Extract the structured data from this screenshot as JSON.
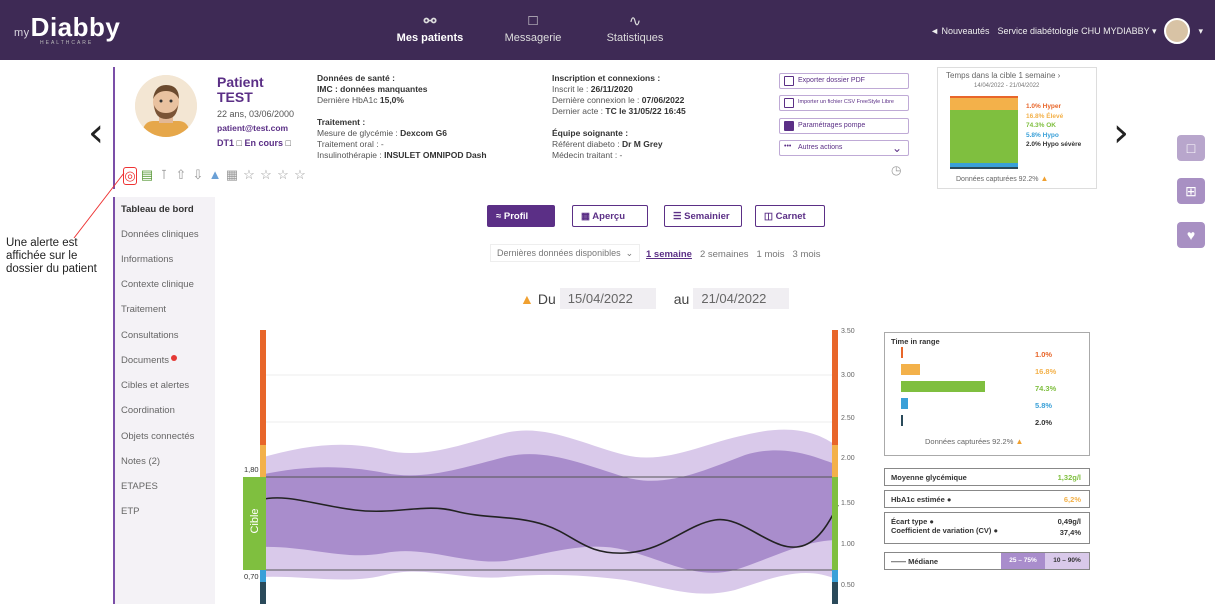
{
  "app": {
    "logo_prefix": "my",
    "logo_name": "Diabby",
    "logo_sub": "HEALTHCARE"
  },
  "nav": [
    {
      "label": "Mes patients",
      "icon": "patients-icon",
      "active": true
    },
    {
      "label": "Messagerie",
      "icon": "chat-icon",
      "active": false
    },
    {
      "label": "Statistiques",
      "icon": "stats-icon",
      "active": false
    }
  ],
  "topright": {
    "news": "Nouveautés",
    "service": "Service diabétologie CHU MYDIABBY"
  },
  "patient": {
    "label": "Patient",
    "lastname": "TEST",
    "age_birth": "22 ans, 03/06/2000",
    "email": "patient@test.com",
    "type": "DT1",
    "status": "En cours"
  },
  "health": {
    "title": "Données de santé :",
    "imc": "IMC : données manquantes",
    "hba1c_label": "Dernière HbA1c",
    "hba1c_value": "15,0%",
    "treatment_title": "Traitement :",
    "glycemia_label": "Mesure de glycémie :",
    "glycemia_value": "Dexcom G6",
    "oral": "Traitement oral : -",
    "insulin_label": "Insulinothérapie :",
    "insulin_value": "INSULET OMNIPOD Dash"
  },
  "inscription": {
    "title": "Inscription et connexions :",
    "registered_label": "Inscrit le :",
    "registered_value": "26/11/2020",
    "lastlogin_label": "Dernière connexion le :",
    "lastlogin_value": "07/06/2022",
    "lastact_label": "Dernier acte :",
    "lastact_value": "TC le 31/05/22 16:45",
    "team_title": "Équipe soignante :",
    "referent_label": "Référent diabeto :",
    "referent_value": "Dr M Grey",
    "gp": "Médecin traitant : -"
  },
  "actions": {
    "export_pdf": "Exporter dossier PDF",
    "import_csv": "Importer un fichier CSV FreeStyle Libre",
    "pump": "Paramétrages pompe",
    "other": "Autres actions"
  },
  "tir_card": {
    "title": "Temps dans la cible 1 semaine",
    "period": "14/04/2022 - 21/04/2022",
    "items": [
      {
        "value": "1.0%",
        "label": "Hyper",
        "color": "#e8662a"
      },
      {
        "value": "16.8%",
        "label": "Élevé",
        "color": "#f3b14a"
      },
      {
        "value": "74.3%",
        "label": "OK",
        "color": "#7fbf3f"
      },
      {
        "value": "5.8%",
        "label": "Hypo",
        "color": "#3aa0d8"
      },
      {
        "value": "2.0%",
        "label": "Hypo sévère",
        "color": "#2a4a5a"
      }
    ],
    "captured": "Données capturées 92.2%"
  },
  "menu": [
    "Tableau de bord",
    "Données cliniques",
    "Informations",
    "Contexte clinique",
    "Traitement",
    "Consultations",
    "Documents",
    "Cibles et alertes",
    "Coordination",
    "Objets connectés",
    "Notes (2)",
    "ETAPES",
    "ETP"
  ],
  "annotation": "Une alerte est affichée sur le dossier du patient",
  "views": [
    "Profil",
    "Aperçu",
    "Semainier",
    "Carnet"
  ],
  "range": {
    "select": "Dernières données disponibles",
    "periods": [
      "1 semaine",
      "2 semaines",
      "1 mois",
      "3 mois"
    ],
    "from_label": "Du",
    "from": "15/04/2022",
    "to_label": "au",
    "to": "21/04/2022"
  },
  "chart_data": {
    "type": "area",
    "y_right_ticks": [
      "3.50",
      "3.00",
      "2.50",
      "2.00",
      "1.50",
      "1.00",
      "0.50"
    ],
    "target_low": "0,70",
    "target_high": "1,80",
    "target_label": "Cible",
    "median_legend": "Médiane",
    "band_25_75": "25 – 75%",
    "band_10_90": "10 – 90%"
  },
  "tir_panel": {
    "title": "Time in range",
    "items": [
      {
        "value": "1.0%",
        "pct": 1.0,
        "color": "#e8662a"
      },
      {
        "value": "16.8%",
        "pct": 16.8,
        "color": "#f3b14a"
      },
      {
        "value": "74.3%",
        "pct": 74.3,
        "color": "#7fbf3f"
      },
      {
        "value": "5.8%",
        "pct": 5.8,
        "color": "#3aa0d8"
      },
      {
        "value": "2.0%",
        "pct": 2.0,
        "color": "#2a4a5a"
      }
    ],
    "captured": "Données capturées 92.2%"
  },
  "stats": {
    "mean_label": "Moyenne glycémique",
    "mean_value": "1,32g/l",
    "hba1c_label": "HbA1c estimée",
    "hba1c_value": "6,2%",
    "sd_label": "Écart type",
    "sd_value": "0,49g/l",
    "cv_label": "Coefficient de variation (CV)",
    "cv_value": "37,4%"
  }
}
